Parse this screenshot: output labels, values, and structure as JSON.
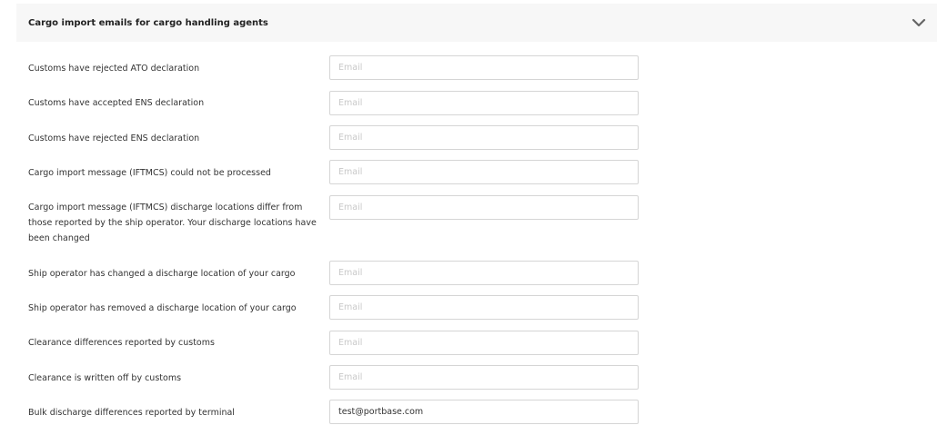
{
  "panel": {
    "title": "Cargo import emails for cargo handling agents",
    "toggle_icon": "chevron-down-icon"
  },
  "email_placeholder": "Email",
  "rows": [
    {
      "label": "Customs have rejected ATO declaration",
      "value": ""
    },
    {
      "label": "Customs have accepted ENS declaration",
      "value": ""
    },
    {
      "label": "Customs have rejected ENS declaration",
      "value": ""
    },
    {
      "label": "Cargo import message (IFTMCS) could not be processed",
      "value": ""
    },
    {
      "label": "Cargo import message (IFTMCS) discharge locations differ from those reported by the ship operator. Your discharge locations have been changed",
      "value": ""
    },
    {
      "label": "Ship operator has changed a discharge location of your cargo",
      "value": ""
    },
    {
      "label": "Ship operator has removed a discharge location of your cargo",
      "value": ""
    },
    {
      "label": "Clearance differences reported by customs",
      "value": ""
    },
    {
      "label": "Clearance is written off by customs",
      "value": ""
    },
    {
      "label": "Bulk discharge differences reported by terminal",
      "value": "test@portbase.com"
    }
  ]
}
